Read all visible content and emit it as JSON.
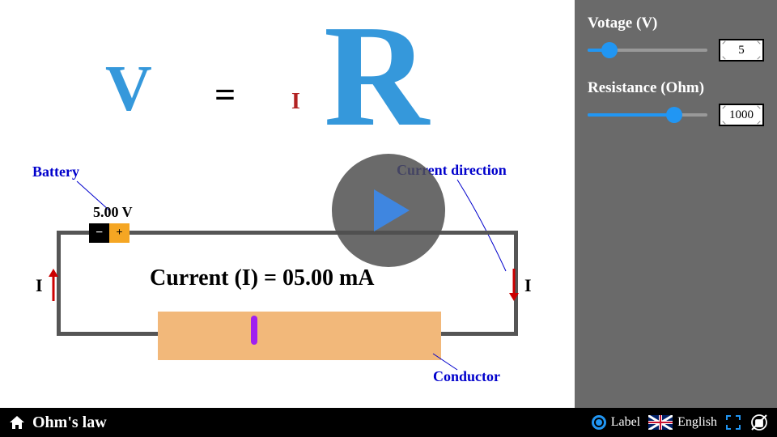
{
  "title": "Ohm's law",
  "formula": {
    "V": "V",
    "eq": "=",
    "I": "I",
    "R": "R"
  },
  "labels": {
    "battery": "Battery",
    "current_direction": "Current direction",
    "conductor": "Conductor",
    "I_left": "I",
    "I_right": "I"
  },
  "battery_voltage": "5.00 V",
  "current_text": "Current (I) = 05.00 mA",
  "controls": {
    "voltage": {
      "label": "Votage (V)",
      "value": "5",
      "percent": 18
    },
    "resistance": {
      "label": "Resistance (Ohm)",
      "value": "1000",
      "percent": 72
    }
  },
  "footer": {
    "label_toggle": "Label",
    "language": "English"
  }
}
